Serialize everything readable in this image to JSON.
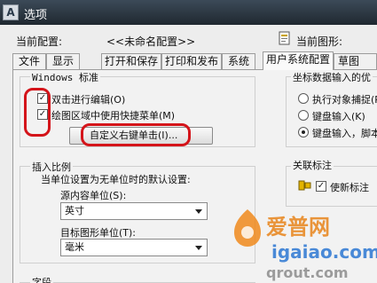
{
  "window": {
    "title": "选项"
  },
  "header": {
    "current_profile_label": "当前配置:",
    "current_profile_value": "<<未命名配置>>",
    "current_drawing_label": "当前图形:"
  },
  "tabs": [
    {
      "label": "文件",
      "active": false
    },
    {
      "label": "显示",
      "active": false
    },
    {
      "label": "打开和保存",
      "active": false
    },
    {
      "label": "打印和发布",
      "active": false
    },
    {
      "label": "系统",
      "active": false
    },
    {
      "label": "用户系统配置",
      "active": true
    },
    {
      "label": "草图",
      "active": false
    }
  ],
  "windows_standard": {
    "title": "Windows 标准",
    "double_click_edit": {
      "label": "双击进行编辑(O)",
      "checked": true
    },
    "shortcut_menus": {
      "label": "绘图区域中使用快捷菜单(M)",
      "checked": true
    },
    "right_click_button": "自定义右键单击(I)..."
  },
  "coordinate_priority": {
    "title": "坐标数据输入的优",
    "options": [
      {
        "label": "执行对象捕捉(R",
        "selected": false
      },
      {
        "label": "键盘输入(K)",
        "selected": false
      },
      {
        "label": "键盘输入，脚本",
        "selected": true
      }
    ]
  },
  "insertion_scale": {
    "title": "插入比例",
    "description": "当单位设置为无单位时的默认设置:",
    "source_label": "源内容单位(S):",
    "source_value": "英寸",
    "target_label": "目标图形单位(T):",
    "target_value": "毫米"
  },
  "associative_dimension": {
    "title": "关联标注",
    "new_dimension": {
      "label": "使新标注",
      "checked": true
    }
  },
  "bottom_group": {
    "title": "字段"
  },
  "watermark": {
    "brand_text": "爱普网",
    "url_text": "igaiao.com",
    "bottom_text": "qrout.com"
  },
  "colors": {
    "annotation_red": "#d4141a",
    "titlebar": "#2b3540",
    "dialog_bg": "#ededed"
  }
}
